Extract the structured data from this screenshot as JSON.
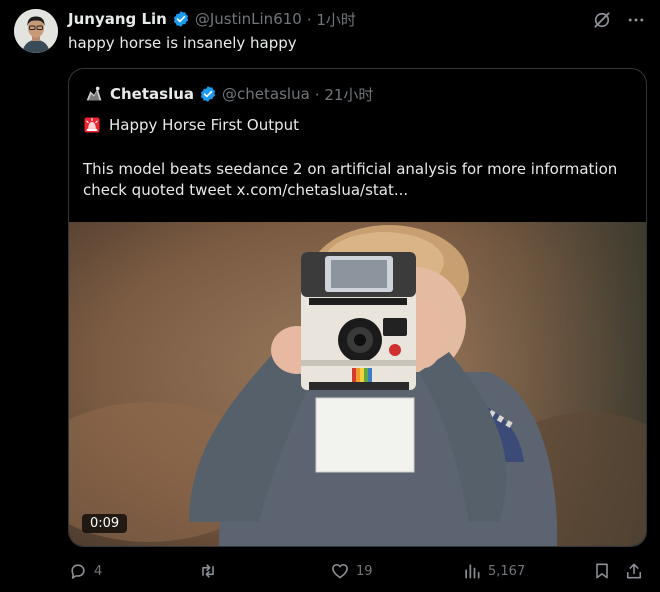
{
  "tweet": {
    "author_name": "Junyang Lin",
    "author_handle": "@JustinLin610",
    "time": "· 1小时",
    "text": "happy horse is insanely happy"
  },
  "quote": {
    "author_name": "Chetaslua",
    "author_handle": "@chetaslua",
    "time": "· 21小时",
    "title": "Happy Horse First Output",
    "body": "This model beats seedance 2 on artificial analysis for more information check quoted tweet  x.com/chetaslua/stat...",
    "video_duration": "0:09"
  },
  "actions": {
    "replies": "4",
    "retweets": "",
    "likes": "19",
    "views": "5,167"
  },
  "colors": {
    "background": "#000000",
    "verified": "#1d9bf0",
    "muted": "#71767b",
    "alert": "#f4212e"
  },
  "icons": {
    "verified": "verified-badge-icon",
    "grok": "grok-icon",
    "more": "more-icon",
    "reply": "reply-icon",
    "retweet": "retweet-icon",
    "like": "like-icon",
    "views": "views-icon",
    "bookmark": "bookmark-icon",
    "share": "share-icon",
    "siren": "siren-icon"
  }
}
